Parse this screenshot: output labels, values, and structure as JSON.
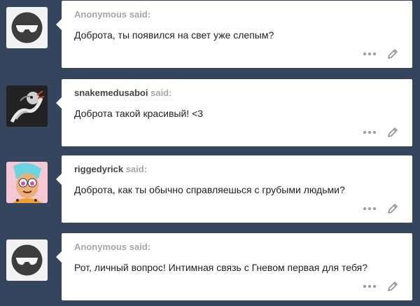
{
  "asks": [
    {
      "asker": "Anonymous",
      "asker_style": "anon",
      "said": " said:",
      "question": "Доброта, ты появился на свет уже слепым?",
      "avatar_icon": "anonymous-sunglasses-icon"
    },
    {
      "asker": "snakemedusaboi",
      "asker_style": "user",
      "said": " said:",
      "question": "Доброта такой красивый! <3",
      "avatar_icon": "snake-avatar"
    },
    {
      "asker": "riggedyrick",
      "asker_style": "user",
      "said": " said:",
      "question": "Доброта, как ты обычно справляешься с грубыми людьми?",
      "avatar_icon": "cartoon-avatar"
    },
    {
      "asker": "Anonymous",
      "asker_style": "anon",
      "said": " said:",
      "question": "Рот, личный вопрос! Интимная связь с Гневом первая для тебя?",
      "avatar_icon": "anonymous-sunglasses-icon"
    }
  ],
  "icons": {
    "more": "more-options-icon",
    "edit": "pencil-icon"
  },
  "colors": {
    "background": "#35455d",
    "card": "#ffffff",
    "asker_anon": "#a7a7a7",
    "asker_user": "#444444",
    "text": "#222222",
    "icon": "#9a9a9a"
  }
}
